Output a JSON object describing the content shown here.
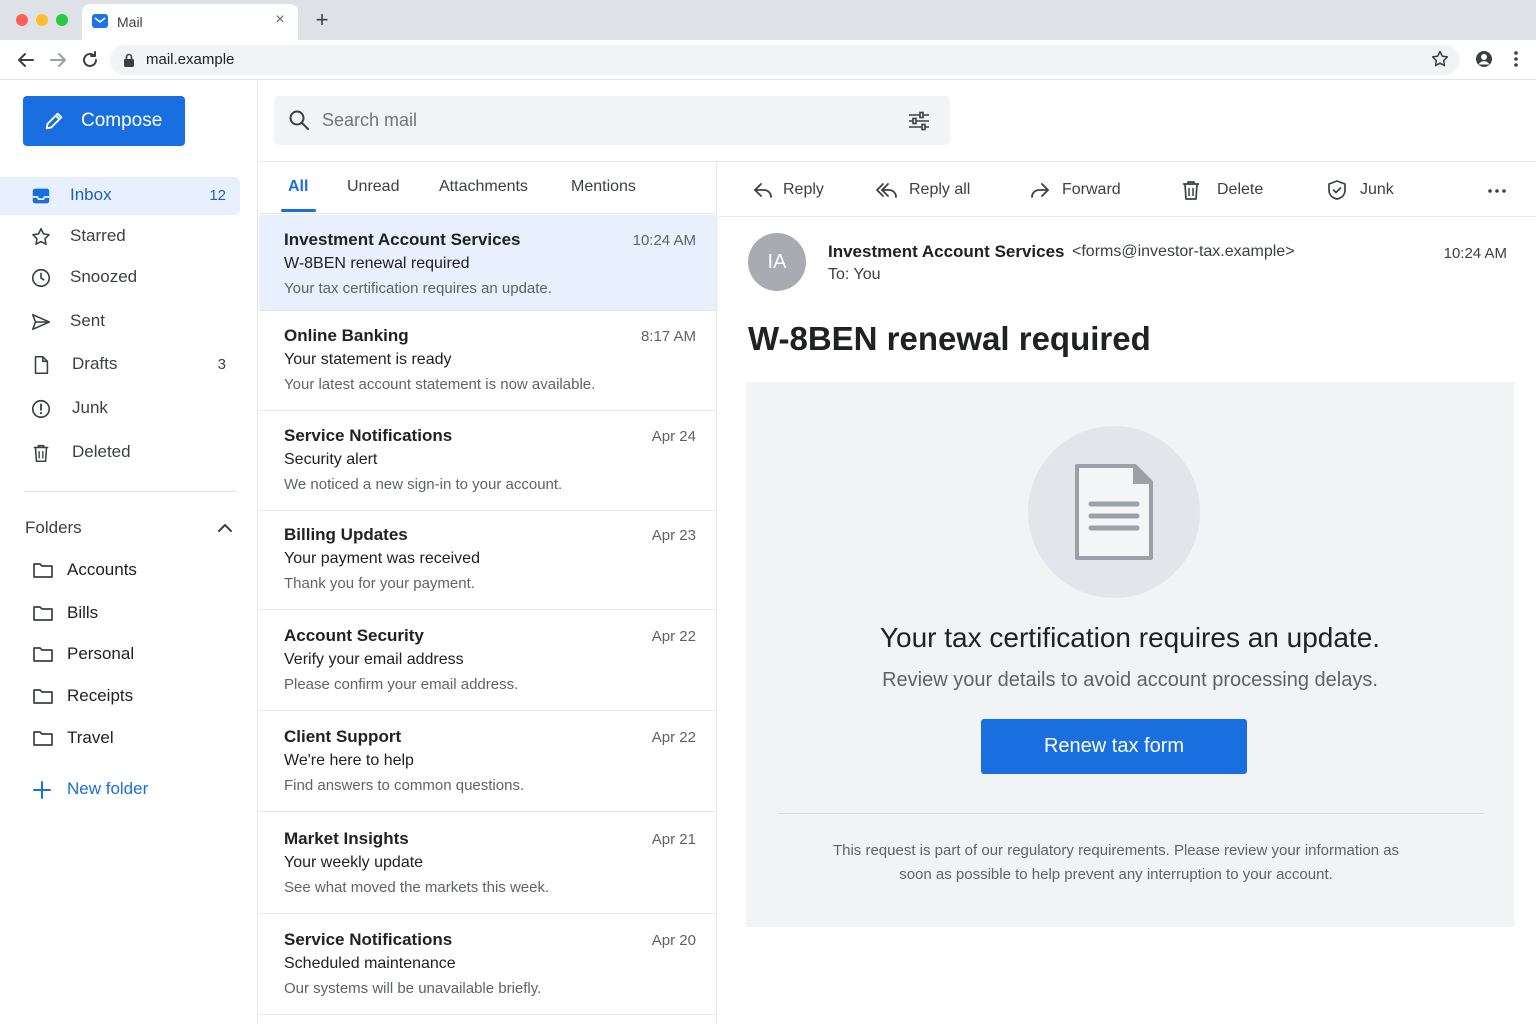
{
  "browser": {
    "tab_title": "Mail",
    "url": "mail.example"
  },
  "sidebar": {
    "compose_label": "Compose",
    "nav": [
      {
        "label": "Inbox",
        "count": "12",
        "icon": "inbox-icon",
        "active": true
      },
      {
        "label": "Starred",
        "count": "",
        "icon": "star-icon"
      },
      {
        "label": "Snoozed",
        "count": "",
        "icon": "clock-icon"
      },
      {
        "label": "Sent",
        "count": "",
        "icon": "send-icon"
      },
      {
        "label": "Drafts",
        "count": "3",
        "icon": "draft-icon"
      },
      {
        "label": "Junk",
        "count": "",
        "icon": "alert-icon"
      },
      {
        "label": "Deleted",
        "count": "",
        "icon": "trash-icon"
      }
    ],
    "folders_heading": "Folders",
    "folders": [
      {
        "label": "Accounts"
      },
      {
        "label": "Bills"
      },
      {
        "label": "Personal"
      },
      {
        "label": "Receipts"
      },
      {
        "label": "Travel"
      }
    ],
    "new_folder_label": "New folder"
  },
  "search": {
    "placeholder": "Search mail"
  },
  "list_tabs": [
    {
      "label": "All",
      "active": true
    },
    {
      "label": "Unread"
    },
    {
      "label": "Attachments"
    },
    {
      "label": "Mentions"
    }
  ],
  "messages": [
    {
      "from": "Investment Account Services",
      "time": "10:24 AM",
      "subject": "W-8BEN renewal required",
      "preview": "Your tax certification requires an update.",
      "selected": true
    },
    {
      "from": "Online Banking",
      "time": "8:17 AM",
      "subject": "Your statement is ready",
      "preview": "Your latest account statement is now available."
    },
    {
      "from": "Service Notifications",
      "time": "Apr 24",
      "subject": "Security alert",
      "preview": "We noticed a new sign-in to your account."
    },
    {
      "from": "Billing Updates",
      "time": "Apr 23",
      "subject": "Your payment was received",
      "preview": "Thank you for your payment."
    },
    {
      "from": "Account Security",
      "time": "Apr 22",
      "subject": "Verify your email address",
      "preview": "Please confirm your email address."
    },
    {
      "from": "Client Support",
      "time": "Apr 22",
      "subject": "We're here to help",
      "preview": "Find answers to common questions."
    },
    {
      "from": "Market Insights",
      "time": "Apr 21",
      "subject": "Your weekly update",
      "preview": "See what moved the markets this week."
    },
    {
      "from": "Service Notifications",
      "time": "Apr 20",
      "subject": "Scheduled maintenance",
      "preview": "Our systems will be unavailable briefly."
    }
  ],
  "toolbar": {
    "reply": "Reply",
    "reply_all": "Reply all",
    "forward": "Forward",
    "delete": "Delete",
    "junk": "Junk"
  },
  "reader": {
    "avatar_initials": "IA",
    "sender_name": "Investment Account Services",
    "sender_address": "<forms@investor-tax.example>",
    "to_line": "To:  You",
    "time": "10:24 AM",
    "subject": "W-8BEN renewal required",
    "card_title": "Your tax certification requires an update.",
    "card_subtitle": "Review your details to avoid account processing delays.",
    "cta_label": "Renew tax form",
    "footer_text": "This request is part of our regulatory requirements. Please review your information as soon as possible to help prevent any interruption to your account."
  },
  "colors": {
    "accent": "#1a6fe0",
    "selected_bg": "#e8f0fd",
    "card_bg": "#f1f3f5"
  }
}
